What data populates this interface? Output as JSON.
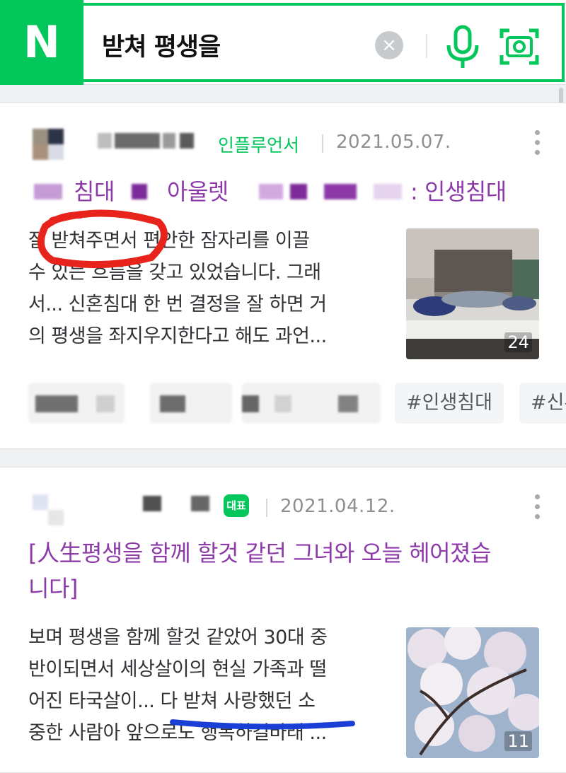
{
  "search": {
    "logo": "N",
    "query": "받쳐 평생을",
    "clear_icon": "clear-icon",
    "voice_icon": "mic-icon",
    "lens_icon": "camera-lens-icon"
  },
  "colors": {
    "brand_green": "#03c75a",
    "title_purple": "#8d3aa8",
    "annotation_red": "#e8231b",
    "annotation_blue": "#1a3fd6"
  },
  "results": [
    {
      "source": "인플루언서",
      "date": "2021.05.07.",
      "title_parts": [
        "침대",
        "아울렛",
        ": 인생침대"
      ],
      "snippet": [
        "잘 받쳐주면서 편안한 잠자리를 이끌",
        "수 있는 흐름을 갖고 있었습니다. 그래",
        "서... 신혼침대 한 번 결정을 잘 하면 거",
        "의 평생을 좌지우지한다고 해도 과언..."
      ],
      "image_count": "24",
      "tags": [
        "#인생침대",
        "#신혼"
      ]
    },
    {
      "badge": "대표",
      "date": "2021.04.12.",
      "title_lines": [
        "[人生평생을 함께 할것 같던 그녀와 오늘 헤어졌습",
        "니다]"
      ],
      "snippet": [
        "보며 평생을 함께 할것 같았어 30대 중",
        "반이되면서 세상살이의 현실 가족과 떨",
        "어진 타국살이... 다 받쳐 사랑했던 소",
        "중한 사람아 앞으로도 행복하길바래 ..."
      ],
      "image_count": "11"
    }
  ]
}
